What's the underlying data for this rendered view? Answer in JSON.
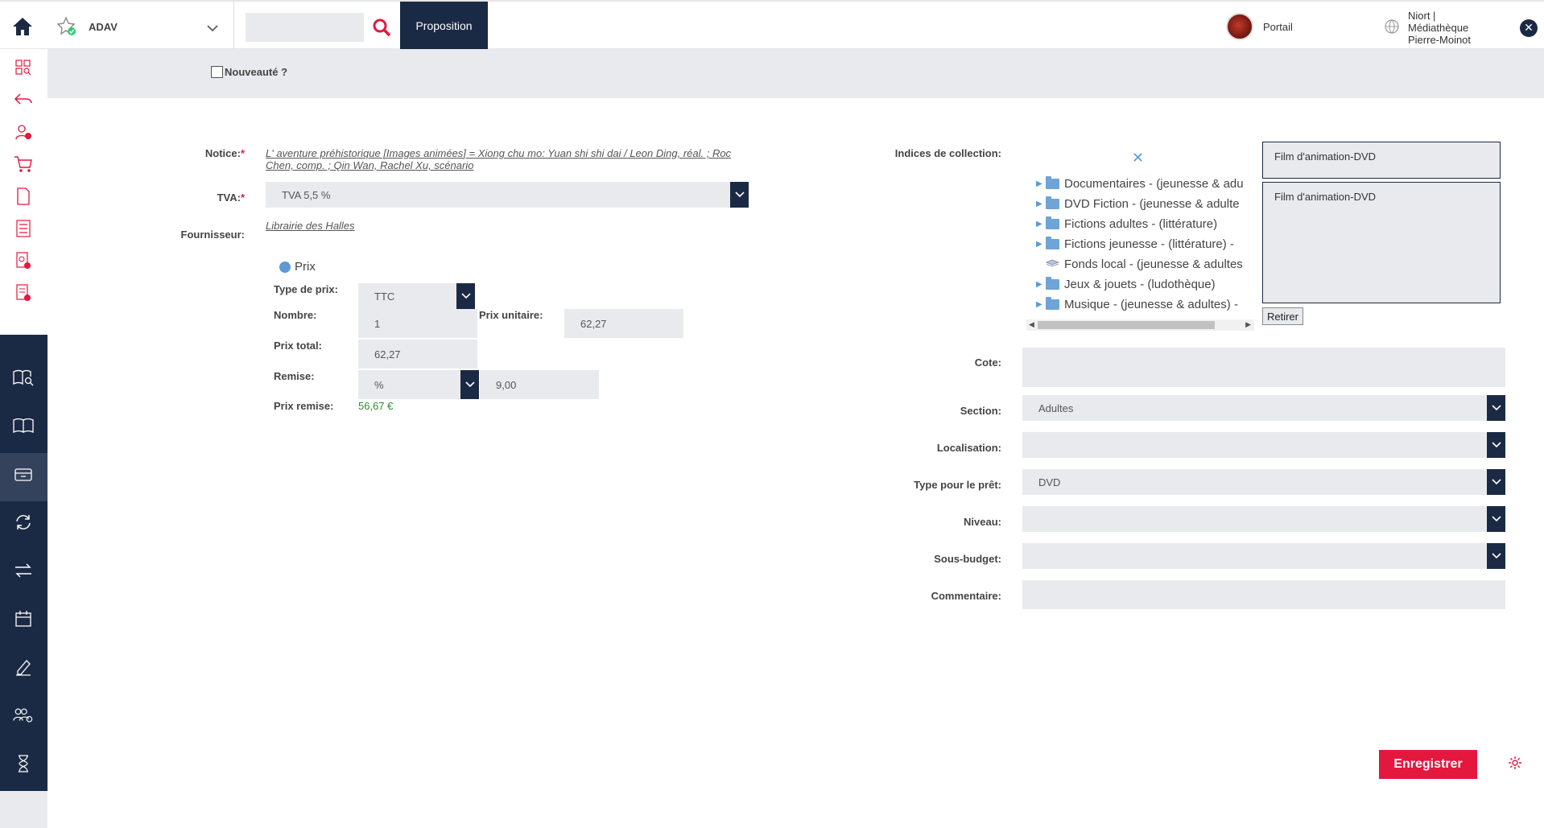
{
  "topbar": {
    "workspace": "ADAV",
    "search_placeholder": "",
    "proposition_label": "Proposition",
    "portail_label": "Portail",
    "library_lines": [
      "Niort |",
      "Médiathèque",
      "Pierre-Moinot"
    ]
  },
  "sidebar": {
    "icons": [
      "dashboard-search-icon",
      "undo-arrow-icon",
      "user-alert-icon",
      "cart-icon",
      "document-icon",
      "checklist-icon",
      "media-alert-icon",
      "note-alert-icon",
      "book-search-icon",
      "open-book-icon",
      "inbox-icon",
      "sync-icon",
      "transfer-arrows-icon",
      "calendar-icon",
      "signature-pen-icon",
      "users-settings-icon",
      "hourglass-icon"
    ]
  },
  "subbar": {
    "nouveaute_label": "Nouveauté ?"
  },
  "form_left": {
    "notice_label": "Notice:",
    "notice_text": "L' aventure préhistorique [Images animées] = Xiong chu mo: Yuan shi shi dai / Leon Ding, réal. ; Roc Chen, comp. ; Qin Wan, Rachel Xu, scénario",
    "tva_label": "TVA:",
    "tva_value": "TVA 5,5 %",
    "fournisseur_label": "Fournisseur:",
    "fournisseur_value": "Librairie des Halles",
    "prix_toggle": "Prix",
    "type_prix_label": "Type de prix:",
    "type_prix_value": "TTC",
    "nombre_label": "Nombre:",
    "nombre_value": "1",
    "prix_unitaire_label": "Prix unitaire:",
    "prix_unitaire_value": "62,27",
    "prix_total_label": "Prix total:",
    "prix_total_value": "62,27",
    "remise_label": "Remise:",
    "remise_type": "%",
    "remise_value": "9,00",
    "prix_remise_label": "Prix remise:",
    "prix_remise_value": "56,67 €",
    "required_mark": "*"
  },
  "form_right": {
    "indices_label": "Indices de collection:",
    "tree_items": [
      {
        "label": "Documentaires - (jeunesse & adu",
        "expandable": true,
        "icon": "folder-icon"
      },
      {
        "label": "DVD Fiction - (jeunesse & adulte",
        "expandable": true,
        "icon": "folder-icon"
      },
      {
        "label": "Fictions adultes - (littérature)",
        "expandable": true,
        "icon": "folder-icon"
      },
      {
        "label": "Fictions jeunesse - (littérature) -",
        "expandable": true,
        "icon": "folder-icon"
      },
      {
        "label": "Fonds local - (jeunesse & adultes",
        "expandable": false,
        "icon": "stack-icon"
      },
      {
        "label": "Jeux & jouets - (ludothèque)",
        "expandable": true,
        "icon": "folder-icon"
      },
      {
        "label": "Musique - (jeunesse & adultes) -",
        "expandable": true,
        "icon": "folder-icon"
      }
    ],
    "selected_top": "Film d'animation-DVD",
    "selected_list": "Film d'animation-DVD",
    "retirer_label": "Retirer",
    "cote_label": "Cote:",
    "cote_value": "",
    "section_label": "Section:",
    "section_value": "Adultes",
    "localisation_label": "Localisation:",
    "localisation_value": "",
    "type_pret_label": "Type pour le prêt:",
    "type_pret_value": "DVD",
    "niveau_label": "Niveau:",
    "niveau_value": "",
    "sous_budget_label": "Sous-budget:",
    "sous_budget_value": "",
    "commentaire_label": "Commentaire:",
    "commentaire_value": ""
  },
  "footer": {
    "save_label": "Enregistrer"
  },
  "colors": {
    "navy": "#1b2a44",
    "accent_red": "#e4173e",
    "field_bg": "#e9eaee",
    "green": "#2e8b2e"
  }
}
